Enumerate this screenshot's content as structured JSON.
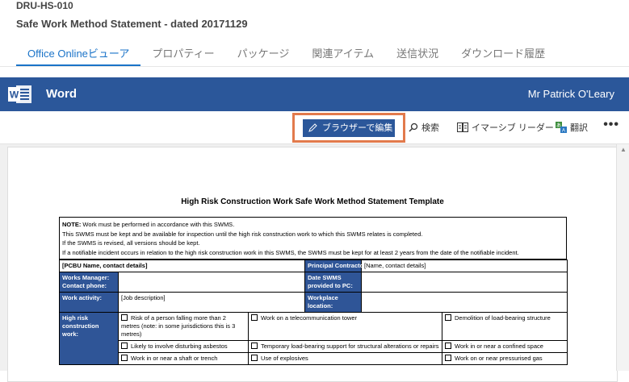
{
  "doc_id": "DRU-HS-010",
  "doc_title": "Safe Work Method Statement - dated 20171129",
  "tabs": [
    "Office Onlineビューア",
    "プロパティー",
    "パッケージ",
    "関連アイテム",
    "送信状況",
    "ダウンロード履歴"
  ],
  "word": {
    "app_name": "Word",
    "user": "Mr Patrick O'Leary"
  },
  "commands": {
    "edit": "ブラウザーで編集",
    "search": "検索",
    "immersive": "イマーシブ リーダー",
    "translate": "翻訳",
    "more": "•••"
  },
  "colors": {
    "word_blue": "#2b579a",
    "tab_active": "#1a73c8",
    "highlight": "#e27a4c",
    "table_blue": "#2f5597"
  },
  "document": {
    "title": "High Risk Construction Work Safe Work Method Statement Template",
    "note_label": "NOTE:",
    "note_lines": [
      " Work must be performed in accordance with this SWMS.",
      "This SWMS must be kept and be available for inspection until the high risk construction work to which this SWMS relates is completed.",
      "If the SWMS is revised, all versions should be kept.",
      "If a notifiable incident occurs in relation to the high risk construction work in this SWMS, the SWMS must be kept for at least 2 years from the date of the notifiable incident."
    ],
    "pcbu": "[PCBU Name, contact details]",
    "principal_contractor_label": "Principal Contractor (PC)",
    "principal_contractor_value": "[Name, contact details]",
    "works_manager_label": "Works Manager:",
    "contact_phone_label": "Contact phone:",
    "date_swms_label": "Date SWMS provided to PC:",
    "work_activity_label": "Work activity:",
    "work_activity_value": "[Job description]",
    "workplace_location_label": "Workplace location:",
    "high_risk_label": "High risk construction work:",
    "risk_items": [
      [
        "Risk of a person falling more than 2 metres (note: in some jurisdictions this is 3 metres)",
        "Work on a telecommunication tower",
        "Demolition of load-bearing structure"
      ],
      [
        "Likely to involve disturbing asbestos",
        "Temporary load-bearing support for structural alterations or repairs",
        "Work in or near a confined space"
      ],
      [
        "Work in or near a shaft or trench",
        "Use of explosives",
        "Work on or near pressurised gas"
      ]
    ]
  }
}
